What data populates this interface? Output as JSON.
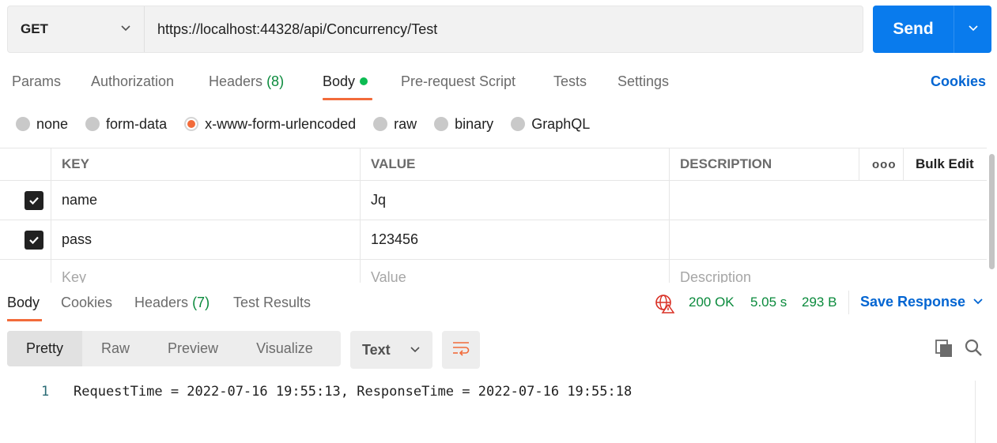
{
  "request": {
    "method": "GET",
    "url": "https://localhost:44328/api/Concurrency/Test",
    "send_label": "Send"
  },
  "tabs": {
    "params": "Params",
    "authorization": "Authorization",
    "headers": "Headers",
    "headers_count": "(8)",
    "body": "Body",
    "prerequest": "Pre-request Script",
    "tests": "Tests",
    "settings": "Settings",
    "cookies": "Cookies"
  },
  "body_types": [
    "none",
    "form-data",
    "x-www-form-urlencoded",
    "raw",
    "binary",
    "GraphQL"
  ],
  "body_type_selected": "x-www-form-urlencoded",
  "table": {
    "headers": {
      "key": "KEY",
      "value": "VALUE",
      "description": "DESCRIPTION",
      "more": "ooo",
      "bulk_edit": "Bulk Edit"
    },
    "rows": [
      {
        "key": "name",
        "value": "Jq",
        "description": "",
        "checked": true
      },
      {
        "key": "pass",
        "value": "123456",
        "description": "",
        "checked": true
      }
    ],
    "placeholders": {
      "key": "Key",
      "value": "Value",
      "description": "Description"
    }
  },
  "response": {
    "tabs": {
      "body": "Body",
      "cookies": "Cookies",
      "headers": "Headers",
      "headers_count": "(7)",
      "test_results": "Test Results"
    },
    "status": "200 OK",
    "time": "5.05 s",
    "size": "293 B",
    "save_label": "Save Response",
    "views": [
      "Pretty",
      "Raw",
      "Preview",
      "Visualize"
    ],
    "format": "Text",
    "line_number": "1",
    "content": "RequestTime = 2022-07-16 19:55:13, ResponseTime = 2022-07-16 19:55:18"
  },
  "colors": {
    "send": "#097bed",
    "accent": "#f26b3a",
    "link": "#0265d2",
    "success": "#0a8a3c",
    "body_dot": "#0cbb52"
  }
}
